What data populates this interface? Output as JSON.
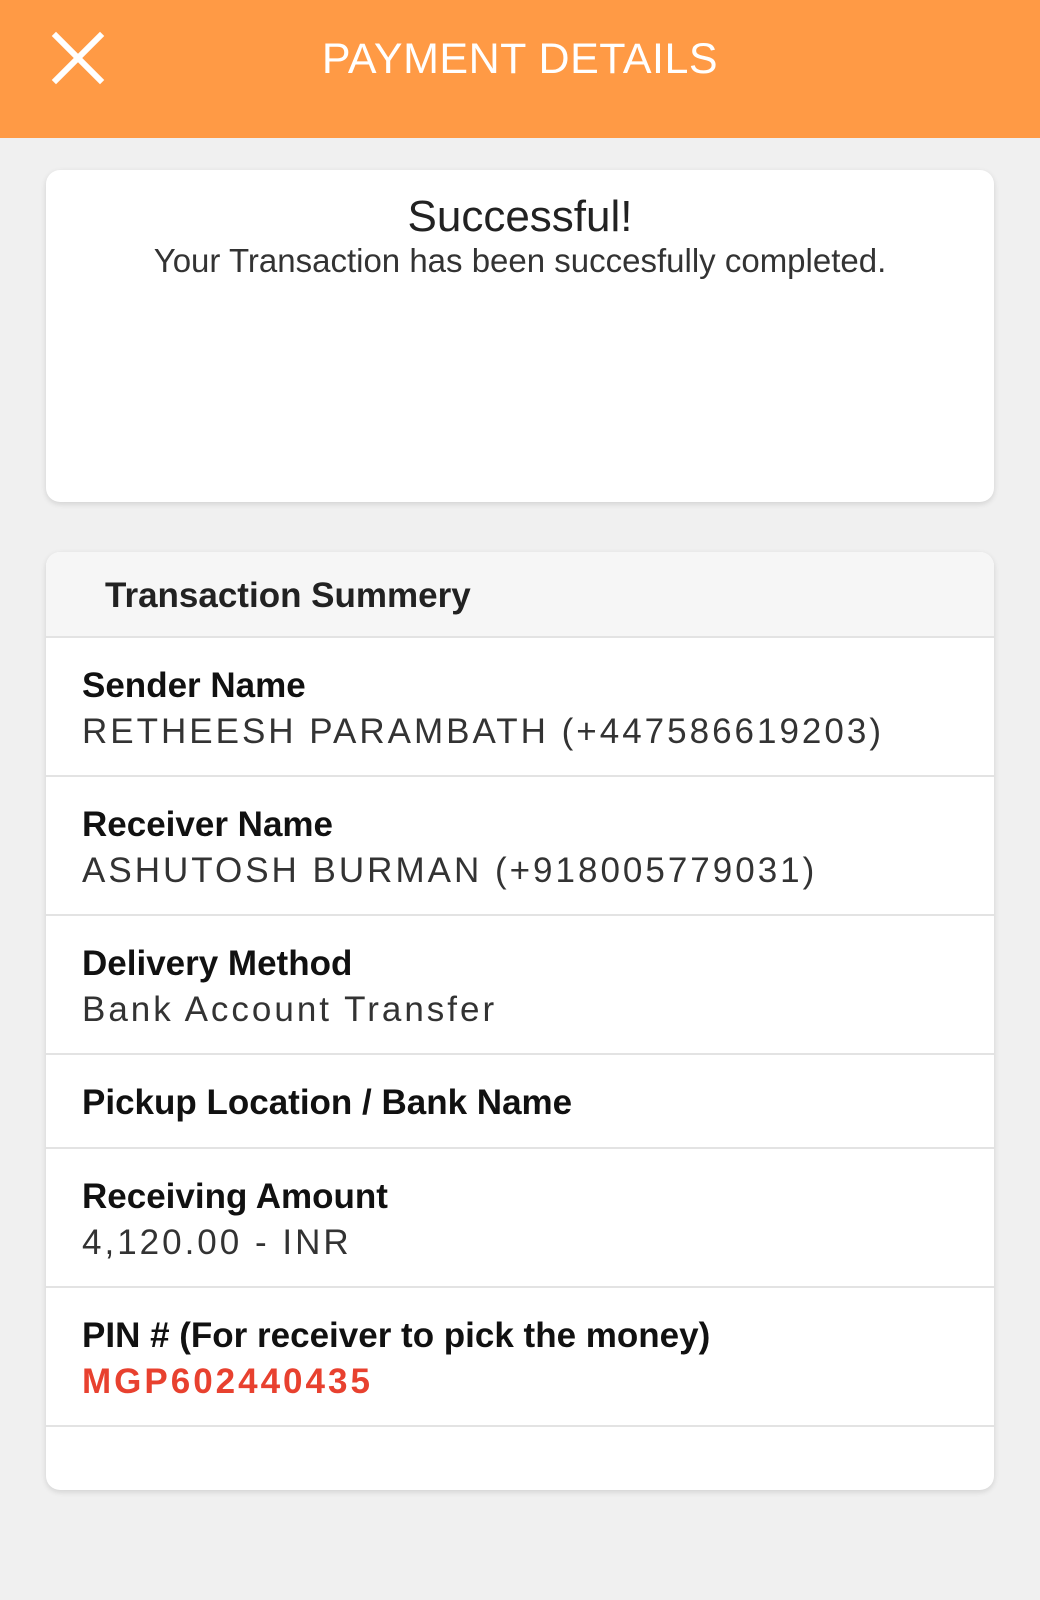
{
  "header": {
    "title": "PAYMENT DETAILS",
    "close_icon": "close-icon",
    "background_color": "#ff9a45"
  },
  "success": {
    "title": "Successful!",
    "message": "Your Transaction has been succesfully completed."
  },
  "summary": {
    "title": "Transaction Summery",
    "rows": [
      {
        "label": "Sender Name",
        "value": "RETHEESH PARAMBATH (+447586619203)"
      },
      {
        "label": "Receiver Name",
        "value": "ASHUTOSH BURMAN (+918005779031)"
      },
      {
        "label": "Delivery Method",
        "value": "Bank Account Transfer"
      },
      {
        "label": "Pickup Location / Bank Name",
        "value": ""
      },
      {
        "label": "Receiving Amount",
        "value": "4,120.00 - INR"
      },
      {
        "label": "PIN # (For receiver to pick the money)",
        "value": "MGP602440435"
      }
    ]
  },
  "colors": {
    "accent": "#ff9a45",
    "pin": "#e8412f",
    "page_background": "#f0f0f0"
  }
}
